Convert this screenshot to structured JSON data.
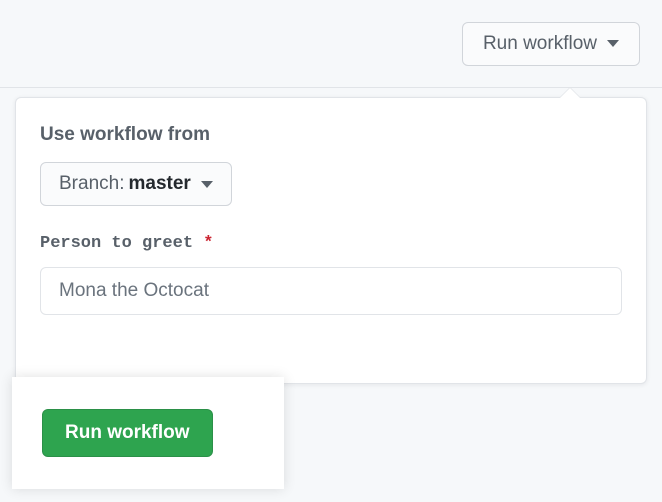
{
  "trigger": {
    "label": "Run workflow"
  },
  "form": {
    "branchSectionLabel": "Use workflow from",
    "branchPrefix": "Branch: ",
    "branchName": "master",
    "inputLabel": "Person to greet",
    "requiredMark": "*",
    "inputValue": "Mona the Octocat",
    "submitLabel": "Run workflow"
  }
}
